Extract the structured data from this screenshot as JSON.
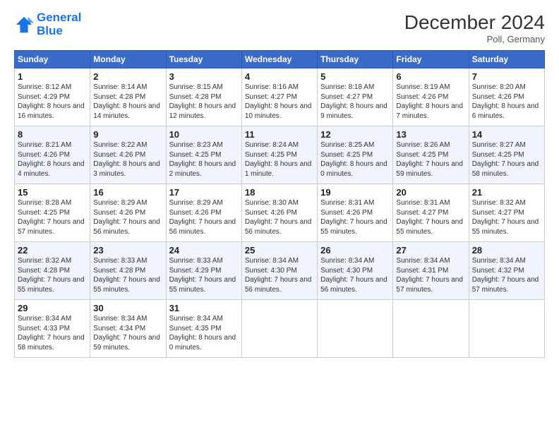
{
  "logo": {
    "line1": "General",
    "line2": "Blue"
  },
  "title": "December 2024",
  "location": "Poll, Germany",
  "days_header": [
    "Sunday",
    "Monday",
    "Tuesday",
    "Wednesday",
    "Thursday",
    "Friday",
    "Saturday"
  ],
  "weeks": [
    [
      {
        "day": "1",
        "sunrise": "8:12 AM",
        "sunset": "4:29 PM",
        "daylight": "8 hours and 16 minutes."
      },
      {
        "day": "2",
        "sunrise": "8:14 AM",
        "sunset": "4:28 PM",
        "daylight": "8 hours and 14 minutes."
      },
      {
        "day": "3",
        "sunrise": "8:15 AM",
        "sunset": "4:28 PM",
        "daylight": "8 hours and 12 minutes."
      },
      {
        "day": "4",
        "sunrise": "8:16 AM",
        "sunset": "4:27 PM",
        "daylight": "8 hours and 10 minutes."
      },
      {
        "day": "5",
        "sunrise": "8:18 AM",
        "sunset": "4:27 PM",
        "daylight": "8 hours and 9 minutes."
      },
      {
        "day": "6",
        "sunrise": "8:19 AM",
        "sunset": "4:26 PM",
        "daylight": "8 hours and 7 minutes."
      },
      {
        "day": "7",
        "sunrise": "8:20 AM",
        "sunset": "4:26 PM",
        "daylight": "8 hours and 6 minutes."
      }
    ],
    [
      {
        "day": "8",
        "sunrise": "8:21 AM",
        "sunset": "4:26 PM",
        "daylight": "8 hours and 4 minutes."
      },
      {
        "day": "9",
        "sunrise": "8:22 AM",
        "sunset": "4:26 PM",
        "daylight": "8 hours and 3 minutes."
      },
      {
        "day": "10",
        "sunrise": "8:23 AM",
        "sunset": "4:25 PM",
        "daylight": "8 hours and 2 minutes."
      },
      {
        "day": "11",
        "sunrise": "8:24 AM",
        "sunset": "4:25 PM",
        "daylight": "8 hours and 1 minute."
      },
      {
        "day": "12",
        "sunrise": "8:25 AM",
        "sunset": "4:25 PM",
        "daylight": "8 hours and 0 minutes."
      },
      {
        "day": "13",
        "sunrise": "8:26 AM",
        "sunset": "4:25 PM",
        "daylight": "7 hours and 59 minutes."
      },
      {
        "day": "14",
        "sunrise": "8:27 AM",
        "sunset": "4:25 PM",
        "daylight": "7 hours and 58 minutes."
      }
    ],
    [
      {
        "day": "15",
        "sunrise": "8:28 AM",
        "sunset": "4:25 PM",
        "daylight": "7 hours and 57 minutes."
      },
      {
        "day": "16",
        "sunrise": "8:29 AM",
        "sunset": "4:26 PM",
        "daylight": "7 hours and 56 minutes."
      },
      {
        "day": "17",
        "sunrise": "8:29 AM",
        "sunset": "4:26 PM",
        "daylight": "7 hours and 56 minutes."
      },
      {
        "day": "18",
        "sunrise": "8:30 AM",
        "sunset": "4:26 PM",
        "daylight": "7 hours and 56 minutes."
      },
      {
        "day": "19",
        "sunrise": "8:31 AM",
        "sunset": "4:26 PM",
        "daylight": "7 hours and 55 minutes."
      },
      {
        "day": "20",
        "sunrise": "8:31 AM",
        "sunset": "4:27 PM",
        "daylight": "7 hours and 55 minutes."
      },
      {
        "day": "21",
        "sunrise": "8:32 AM",
        "sunset": "4:27 PM",
        "daylight": "7 hours and 55 minutes."
      }
    ],
    [
      {
        "day": "22",
        "sunrise": "8:32 AM",
        "sunset": "4:28 PM",
        "daylight": "7 hours and 55 minutes."
      },
      {
        "day": "23",
        "sunrise": "8:33 AM",
        "sunset": "4:28 PM",
        "daylight": "7 hours and 55 minutes."
      },
      {
        "day": "24",
        "sunrise": "8:33 AM",
        "sunset": "4:29 PM",
        "daylight": "7 hours and 55 minutes."
      },
      {
        "day": "25",
        "sunrise": "8:34 AM",
        "sunset": "4:30 PM",
        "daylight": "7 hours and 56 minutes."
      },
      {
        "day": "26",
        "sunrise": "8:34 AM",
        "sunset": "4:30 PM",
        "daylight": "7 hours and 56 minutes."
      },
      {
        "day": "27",
        "sunrise": "8:34 AM",
        "sunset": "4:31 PM",
        "daylight": "7 hours and 57 minutes."
      },
      {
        "day": "28",
        "sunrise": "8:34 AM",
        "sunset": "4:32 PM",
        "daylight": "7 hours and 57 minutes."
      }
    ],
    [
      {
        "day": "29",
        "sunrise": "8:34 AM",
        "sunset": "4:33 PM",
        "daylight": "7 hours and 58 minutes."
      },
      {
        "day": "30",
        "sunrise": "8:34 AM",
        "sunset": "4:34 PM",
        "daylight": "7 hours and 59 minutes."
      },
      {
        "day": "31",
        "sunrise": "8:34 AM",
        "sunset": "4:35 PM",
        "daylight": "8 hours and 0 minutes."
      },
      null,
      null,
      null,
      null
    ]
  ]
}
